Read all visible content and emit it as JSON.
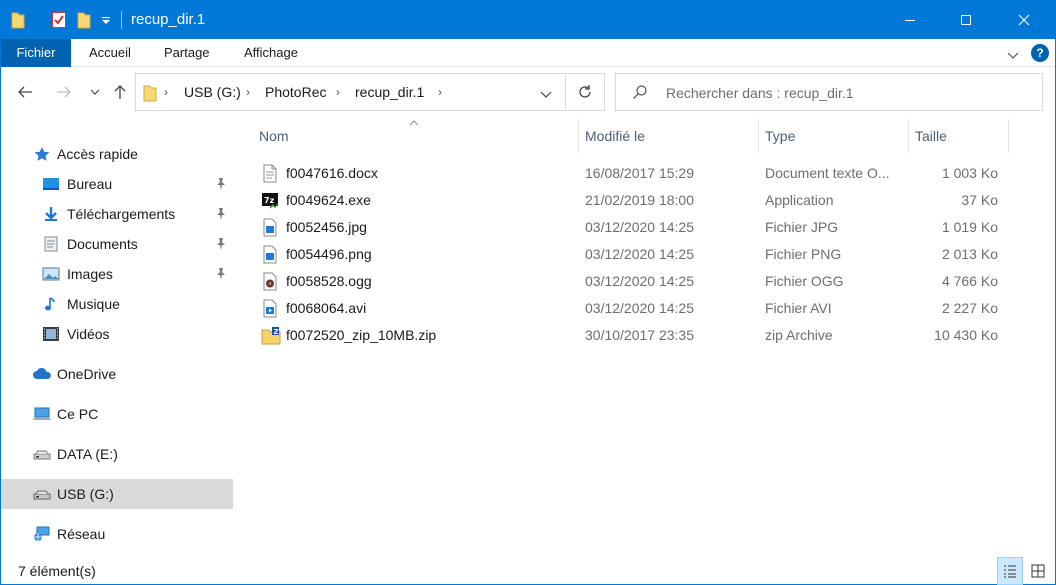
{
  "window": {
    "title": "recup_dir.1",
    "accent": "#0078d7"
  },
  "ribbon": {
    "tabs": [
      "Fichier",
      "Accueil",
      "Partage",
      "Affichage"
    ],
    "help_label": "?"
  },
  "address": {
    "crumbs": [
      "USB (G:)",
      "PhotoRec",
      "recup_dir.1"
    ]
  },
  "search": {
    "placeholder": "Rechercher dans : recup_dir.1"
  },
  "sidebar": {
    "items": [
      {
        "label": "Accès rapide",
        "icon": "star-icon"
      },
      {
        "label": "Bureau",
        "icon": "desktop-icon",
        "pinned": true
      },
      {
        "label": "Téléchargements",
        "icon": "download-icon",
        "pinned": true
      },
      {
        "label": "Documents",
        "icon": "documents-icon",
        "pinned": true
      },
      {
        "label": "Images",
        "icon": "pictures-icon",
        "pinned": true
      },
      {
        "label": "Musique",
        "icon": "music-icon"
      },
      {
        "label": "Vidéos",
        "icon": "videos-icon"
      },
      {
        "label": "OneDrive",
        "icon": "cloud-icon"
      },
      {
        "label": "Ce PC",
        "icon": "computer-icon"
      },
      {
        "label": "DATA (E:)",
        "icon": "drive-icon"
      },
      {
        "label": "USB (G:)",
        "icon": "usb-drive-icon",
        "selected": true
      },
      {
        "label": "Réseau",
        "icon": "network-icon"
      }
    ]
  },
  "columns": {
    "name": "Nom",
    "modified": "Modifié le",
    "type": "Type",
    "size": "Taille"
  },
  "files": [
    {
      "name": "f0047616.docx",
      "modified": "16/08/2017 15:29",
      "type": "Document texte O...",
      "size": "1 003 Ko",
      "icon": "docx-file-icon"
    },
    {
      "name": "f0049624.exe",
      "modified": "21/02/2019 18:00",
      "type": "Application",
      "size": "37 Ko",
      "icon": "7zip-exe-icon"
    },
    {
      "name": "f0052456.jpg",
      "modified": "03/12/2020 14:25",
      "type": "Fichier JPG",
      "size": "1 019 Ko",
      "icon": "image-file-icon"
    },
    {
      "name": "f0054496.png",
      "modified": "03/12/2020 14:25",
      "type": "Fichier PNG",
      "size": "2 013 Ko",
      "icon": "image-file-icon"
    },
    {
      "name": "f0058528.ogg",
      "modified": "03/12/2020 14:25",
      "type": "Fichier OGG",
      "size": "4 766 Ko",
      "icon": "audio-file-icon"
    },
    {
      "name": "f0068064.avi",
      "modified": "03/12/2020 14:25",
      "type": "Fichier AVI",
      "size": "2 227 Ko",
      "icon": "video-file-icon"
    },
    {
      "name": "f0072520_zip_10MB.zip",
      "modified": "30/10/2017 23:35",
      "type": "zip Archive",
      "size": "10 430 Ko",
      "icon": "zip-file-icon"
    }
  ],
  "status": {
    "count_text": "7 élément(s)"
  }
}
